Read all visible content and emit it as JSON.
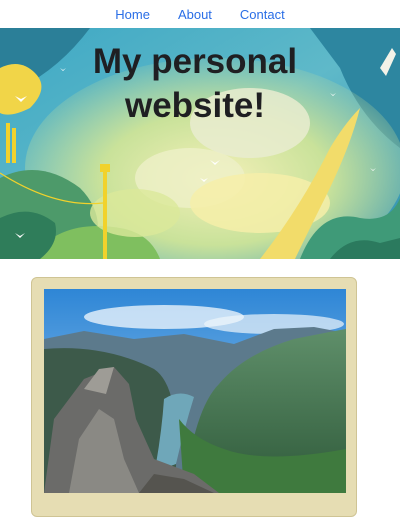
{
  "nav": {
    "items": [
      {
        "label": "Home"
      },
      {
        "label": "About"
      },
      {
        "label": "Contact"
      }
    ],
    "link_color": "#2a6ee6"
  },
  "hero": {
    "title": "My personal\nwebsite!",
    "illustration": "painted-sky-with-clouds-birds-and-lamp-post"
  },
  "photo_card": {
    "image": "mountain-fjord-landscape-photo",
    "frame_color": "#e6ddb3"
  }
}
